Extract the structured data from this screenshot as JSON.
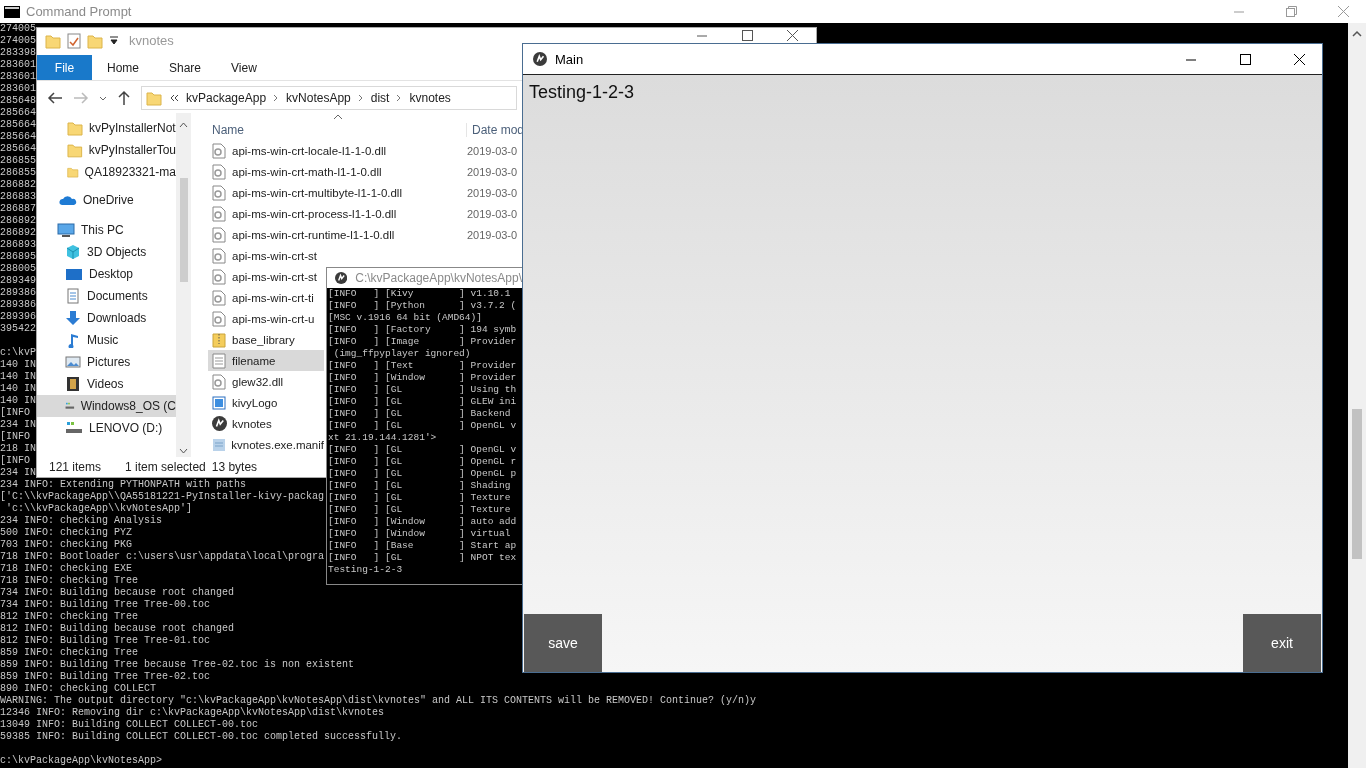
{
  "console": {
    "title": "Command Prompt",
    "blocks": [
      [
        "274005",
        "274005",
        "283398",
        "283601",
        "283601",
        "283601",
        "285648",
        "285664",
        "285664",
        "285664",
        "285664",
        "286855",
        "286855",
        "286882",
        "286883",
        "286887",
        "286892",
        "286892",
        "286893",
        "286895",
        "288005",
        "289349",
        "289386",
        "289386",
        "289396",
        "395422"
      ],
      [
        "c:\\kvP",
        "140 IN",
        "140 IN",
        "140 IN",
        "140 IN",
        "[INFO",
        "234 IN",
        "[INFO",
        "218 IN",
        "[INFO",
        "234 IN",
        "234 INFO: Extending PYTHONPATH with paths",
        "['C:\\\\kvPackageApp\\\\QA55181221-PyInstaller-kivy-packag",
        " 'c:\\\\kvPackageApp\\\\kvNotesApp']",
        "234 INFO: checking Analysis",
        "500 INFO: checking PYZ",
        "703 INFO: checking PKG",
        "718 INFO: Bootloader c:\\users\\usr\\appdata\\local\\progra",
        "718 INFO: checking EXE",
        "718 INFO: checking Tree",
        "734 INFO: Building because root changed",
        "734 INFO: Building Tree Tree-00.toc",
        "812 INFO: checking Tree",
        "812 INFO: Building because root changed",
        "812 INFO: Building Tree Tree-01.toc",
        "859 INFO: checking Tree",
        "859 INFO: Building Tree because Tree-02.toc is non existent",
        "859 INFO: Building Tree Tree-02.toc",
        "890 INFO: checking COLLECT",
        "WARNING: The output directory \"c:\\kvPackageApp\\kvNotesApp\\dist\\kvnotes\" and ALL ITS CONTENTS will be REMOVED! Continue? (y/n)y",
        "12346 INFO: Removing dir c:\\kvPackageApp\\kvNotesApp\\dist\\kvnotes",
        "13049 INFO: Building COLLECT COLLECT-00.toc",
        "59385 INFO: Building COLLECT COLLECT-00.toc completed successfully."
      ],
      [
        "c:\\kvPackageApp\\kvNotesApp>"
      ]
    ]
  },
  "explorer": {
    "title": "kvnotes",
    "ribbon_tabs": [
      {
        "label": "File",
        "kind": "file"
      },
      {
        "label": "Home",
        "kind": "tab"
      },
      {
        "label": "Share",
        "kind": "tab"
      },
      {
        "label": "View",
        "kind": "tab"
      }
    ],
    "path": [
      "kvPackageApp",
      "kvNotesApp",
      "dist",
      "kvnotes"
    ],
    "nav": [
      {
        "label": "kvPyInstallerNot",
        "kind": "folder",
        "selected": false
      },
      {
        "label": "kvPyInstallerTou",
        "kind": "folder",
        "selected": false
      },
      {
        "label": "QA18923321-ma",
        "kind": "folder",
        "selected": false
      },
      {
        "label": "OneDrive",
        "kind": "cloud",
        "selected": false
      },
      {
        "label": "This PC",
        "kind": "pc",
        "selected": false,
        "children": [
          {
            "label": "3D Objects",
            "kind": "cube",
            "selected": false
          },
          {
            "label": "Desktop",
            "kind": "desktop",
            "selected": false
          },
          {
            "label": "Documents",
            "kind": "documents",
            "selected": false
          },
          {
            "label": "Downloads",
            "kind": "downloads",
            "selected": false
          },
          {
            "label": "Music",
            "kind": "music",
            "selected": false
          },
          {
            "label": "Pictures",
            "kind": "pictures",
            "selected": false
          },
          {
            "label": "Videos",
            "kind": "videos",
            "selected": false
          },
          {
            "label": "Windows8_OS (C",
            "kind": "drive",
            "selected": true
          },
          {
            "label": "LENOVO (D:)",
            "kind": "drive",
            "selected": false
          }
        ]
      }
    ],
    "columns": [
      "Name",
      "Date mod"
    ],
    "files": [
      {
        "name": "api-ms-win-crt-locale-l1-1-0.dll",
        "kind": "dll",
        "date": "2019-03-0",
        "selected": false
      },
      {
        "name": "api-ms-win-crt-math-l1-1-0.dll",
        "kind": "dll",
        "date": "2019-03-0",
        "selected": false
      },
      {
        "name": "api-ms-win-crt-multibyte-l1-1-0.dll",
        "kind": "dll",
        "date": "2019-03-0",
        "selected": false
      },
      {
        "name": "api-ms-win-crt-process-l1-1-0.dll",
        "kind": "dll",
        "date": "2019-03-0",
        "selected": false
      },
      {
        "name": "api-ms-win-crt-runtime-l1-1-0.dll",
        "kind": "dll",
        "date": "2019-03-0",
        "selected": false
      },
      {
        "name": "api-ms-win-crt-st",
        "kind": "dll",
        "selected": false
      },
      {
        "name": "api-ms-win-crt-st",
        "kind": "dll",
        "selected": false
      },
      {
        "name": "api-ms-win-crt-ti",
        "kind": "dll",
        "selected": false
      },
      {
        "name": "api-ms-win-crt-u",
        "kind": "dll",
        "selected": false
      },
      {
        "name": "base_library",
        "kind": "zip",
        "selected": false
      },
      {
        "name": "filename",
        "kind": "text",
        "selected": true
      },
      {
        "name": "glew32.dll",
        "kind": "dll",
        "selected": false
      },
      {
        "name": "kivyLogo",
        "kind": "image",
        "selected": false
      },
      {
        "name": "kvnotes",
        "kind": "app",
        "selected": false
      },
      {
        "name": "kvnotes.exe.manif",
        "kind": "manifest",
        "selected": false
      }
    ],
    "status": {
      "count": "121 items",
      "selection": "1 item selected",
      "size": "13 bytes"
    }
  },
  "kivy_console": {
    "title": "C:\\kvPackageApp\\kvNotesApp\\",
    "lines": [
      "[INFO   ] [Kivy        ] v1.10.1",
      "[INFO   ] [Python      ] v3.7.2 (",
      "[MSC v.1916 64 bit (AMD64)]",
      "[INFO   ] [Factory     ] 194 symb",
      "[INFO   ] [Image       ] Provider",
      " (img_ffpyplayer ignored)",
      "[INFO   ] [Text        ] Provider",
      "[INFO   ] [Window      ] Provider",
      "[INFO   ] [GL          ] Using th",
      "[INFO   ] [GL          ] GLEW ini",
      "[INFO   ] [GL          ] Backend",
      "[INFO   ] [GL          ] OpenGL v",
      "xt 21.19.144.1281'>",
      "[INFO   ] [GL          ] OpenGL v",
      "[INFO   ] [GL          ] OpenGL r",
      "[INFO   ] [GL          ] OpenGL p",
      "[INFO   ] [GL          ] Shading",
      "[INFO   ] [GL          ] Texture",
      "[INFO   ] [GL          ] Texture",
      "[INFO   ] [Window      ] auto add",
      "[INFO   ] [Window      ] virtual",
      "[INFO   ] [Base        ] Start ap",
      "[INFO   ] [GL          ] NPOT tex",
      "Testing-1-2-3"
    ]
  },
  "main_window": {
    "title": "Main",
    "label": "Testing-1-2-3",
    "buttons": [
      "save",
      "exit"
    ]
  }
}
